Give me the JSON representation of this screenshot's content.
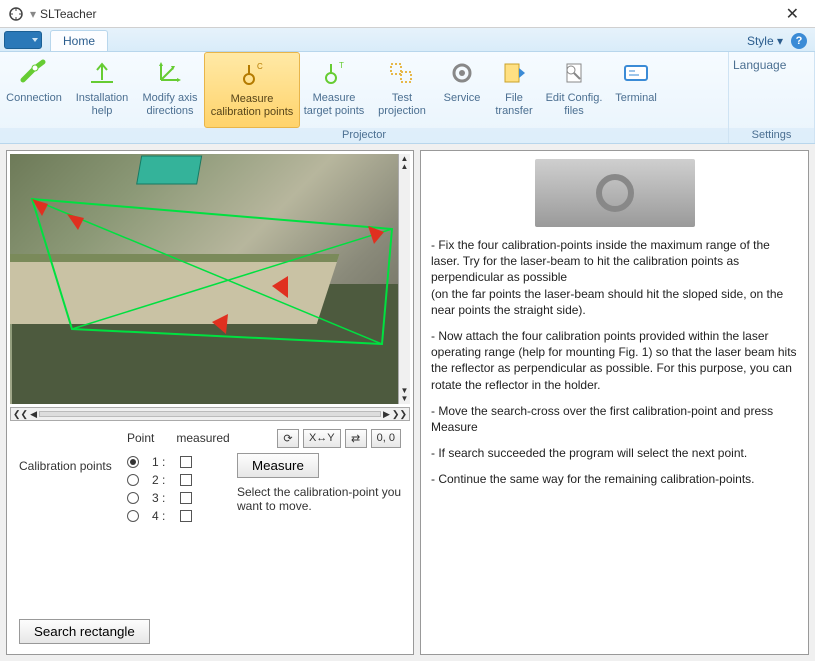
{
  "window": {
    "title": "SLTeacher"
  },
  "ribbon": {
    "tab": "Home",
    "style_label": "Style",
    "groups": {
      "projector": {
        "label": "Projector",
        "items": [
          {
            "key": "connection",
            "label": "Connection"
          },
          {
            "key": "installation-help",
            "label": "Installation help"
          },
          {
            "key": "modify-axis-directions",
            "label": "Modify axis directions"
          },
          {
            "key": "measure-calibration-points",
            "label": "Measure calibration points",
            "active": true
          },
          {
            "key": "measure-target-points",
            "label": "Measure target points"
          },
          {
            "key": "test-projection",
            "label": "Test projection"
          },
          {
            "key": "service",
            "label": "Service"
          },
          {
            "key": "file-transfer",
            "label": "File transfer"
          },
          {
            "key": "edit-config-files",
            "label": "Edit Config. files"
          },
          {
            "key": "terminal",
            "label": "Terminal"
          }
        ]
      },
      "settings": {
        "label": "Settings",
        "items": [
          {
            "key": "language",
            "label": "Language"
          }
        ]
      }
    }
  },
  "viewer": {
    "toolbar": {
      "refresh": "⟳",
      "xy": "X↔Y",
      "swap": "⇄",
      "coords": "0, 0"
    }
  },
  "controls": {
    "col_point": "Point",
    "col_measured": "measured",
    "group_label": "Calibration points",
    "points": [
      {
        "num": "1 :",
        "selected": true
      },
      {
        "num": "2 :",
        "selected": false
      },
      {
        "num": "3 :",
        "selected": false
      },
      {
        "num": "4 :",
        "selected": false
      }
    ],
    "measure_btn": "Measure",
    "hint": "Select the calibration-point you want to move.",
    "search_btn": "Search rectangle"
  },
  "help": {
    "p1": "- Fix the four calibration-points inside the maximum range of the laser. Try for the laser-beam to hit the calibration points as perpendicular as possible",
    "p1b": "(on the far points the laser-beam should hit the sloped side, on the near points the straight side).",
    "p2": "-  Now attach the four calibration points provided within the laser operating range (help for mounting Fig. 1) so that the laser beam hits the reflector as perpendicular as possible. For this purpose, you can rotate the reflector in the holder.",
    "p3": "- Move the search-cross over the first calibration-point and press Measure",
    "p4": "- If search succeeded the program will select the next point.",
    "p5": "- Continue the same way for the remaining calibration-points."
  }
}
